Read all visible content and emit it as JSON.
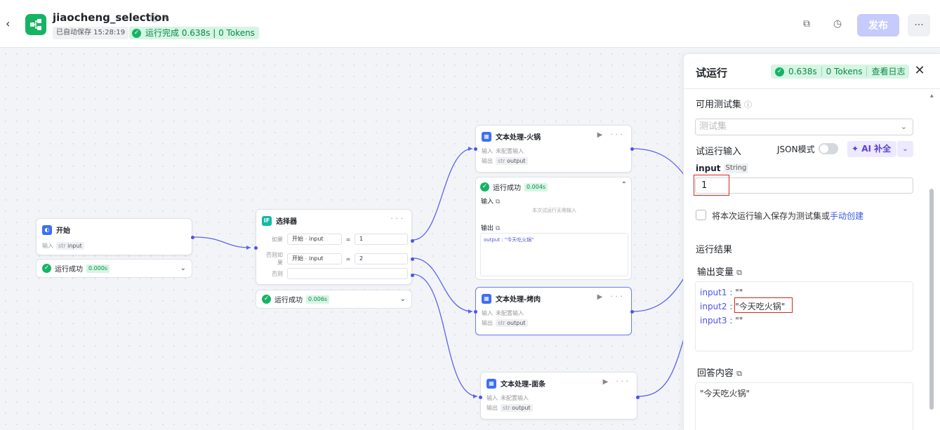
{
  "header": {
    "title": "jiaocheng_selection",
    "autosave": "已自动保存 15:28:19",
    "run_status": "运行完成 0.638s | 0 Tokens",
    "publish_label": "发布"
  },
  "nodes": {
    "start": {
      "title": "开始",
      "input_label": "输入",
      "input_type": "str",
      "input_name": "input",
      "status": "运行成功",
      "time": "0.000s"
    },
    "selector": {
      "title": "选择器",
      "if_label": "如果",
      "elif_label": "否则如果",
      "else_label": "否则",
      "cond1": {
        "left_src": "开始",
        "left_var": "input",
        "op": "=",
        "right": "1"
      },
      "cond2": {
        "left_src": "开始",
        "left_var": "input",
        "op": "=",
        "right": "2"
      },
      "status": "运行成功",
      "time": "0.006s"
    },
    "hotpot": {
      "title": "文本处理-火锅",
      "input_label": "输入",
      "input_value": "未配置输入",
      "output_label": "输出",
      "output_type": "str",
      "output_name": "output"
    },
    "hotpot_result": {
      "status": "运行成功",
      "time": "0.004s",
      "input_label": "输入",
      "empty_text": "本次试运行无需输入",
      "output_label": "输出",
      "output_text": "output : \"今天吃火锅\""
    },
    "bbq": {
      "title": "文本处理-烤肉",
      "input_label": "输入",
      "input_value": "未配置输入",
      "output_label": "输出",
      "output_type": "str",
      "output_name": "output"
    },
    "noodle": {
      "title": "文本处理-面条",
      "input_label": "输入",
      "input_value": "未配置输入",
      "output_label": "输出",
      "output_type": "str",
      "output_name": "output"
    }
  },
  "panel": {
    "title": "试运行",
    "badge_time": "0.638s",
    "badge_tokens": "0 Tokens",
    "badge_log": "查看日志",
    "testset_label": "可用测试集",
    "testset_placeholder": "测试集",
    "run_input_label": "试运行输入",
    "json_mode_label": "JSON模式",
    "ai_fill_label": "AI 补全",
    "input_name": "input",
    "input_type": "String",
    "input_value": "1",
    "save_text": "将本次运行输入保存为测试集或",
    "save_link": "手动创建",
    "result_label": "运行结果",
    "output_var_label": "输出变量",
    "outputs": [
      {
        "key": "input1",
        "value": "\"\""
      },
      {
        "key": "input2",
        "value": "\"今天吃火锅\""
      },
      {
        "key": "input3",
        "value": "\"\""
      }
    ],
    "answer_label": "回答内容",
    "answer_value": "\"今天吃火锅\""
  },
  "colors": {
    "accent": "#4d53e8",
    "success": "#16b364",
    "brand": "#16b364",
    "highlight": "#d9261c"
  }
}
